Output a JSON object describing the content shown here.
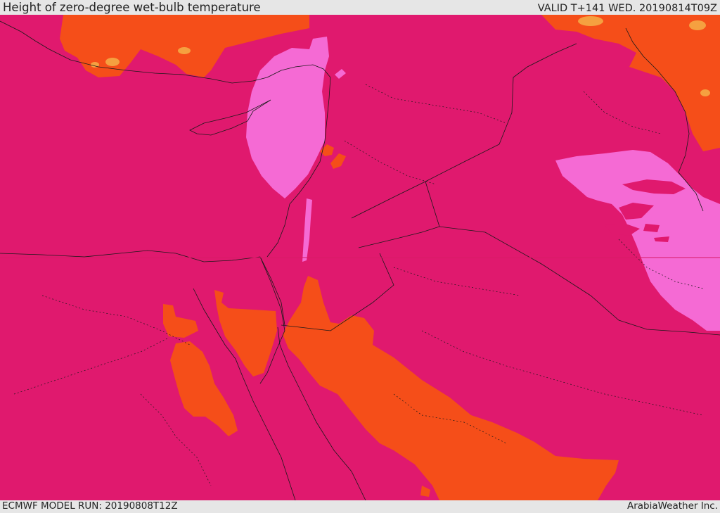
{
  "header": {
    "title": "Height of zero-degree wet-bulb temperature",
    "valid_time": "VALID T+141 WED. 20190814T09Z"
  },
  "footer": {
    "model_run": "ECMWF MODEL RUN: 20190808T12Z",
    "credit": "ArabiaWeather Inc."
  },
  "map": {
    "region": "Eastern Mediterranean, Levant, Iraq and northern Arabia",
    "colors": {
      "base_level": "#e0196e",
      "higher_level": "#f54e19",
      "highest_level": "#f5a040",
      "lower_level": "#f56ad4",
      "borders": "#1a1a1a"
    }
  }
}
